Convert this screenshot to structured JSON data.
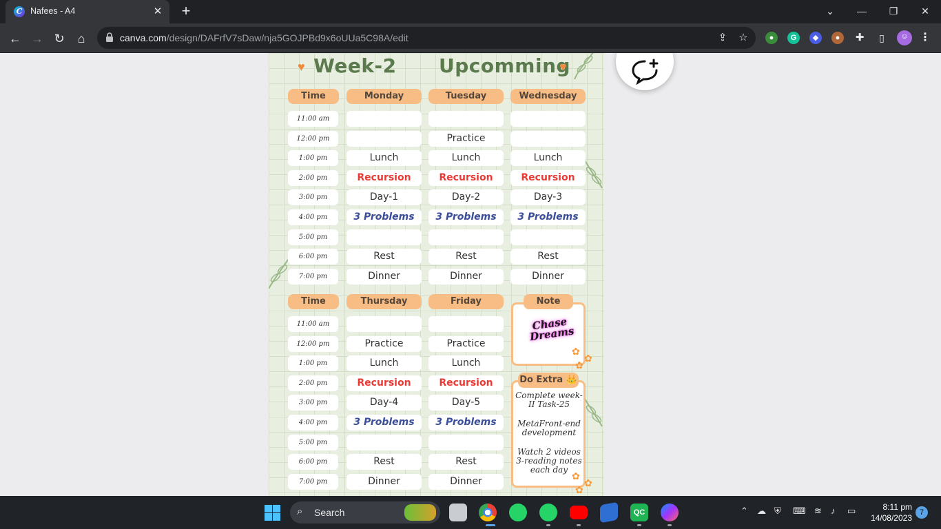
{
  "browser": {
    "tab_title": "Nafees - A4",
    "url_host": "canva.com",
    "url_path": "/design/DAFrfV7sDaw/nja5GOJPBd9x6oUUa5C98A/edit"
  },
  "design": {
    "heading_left": "Week-2",
    "heading_right": "Upcomming",
    "time_header": "Time",
    "week1": {
      "days": [
        "Monday",
        "Tuesday",
        "Wednesday"
      ],
      "times": [
        "11:00 am",
        "12:00 pm",
        "1:00 pm",
        "2:00 pm",
        "3:00 pm",
        "4:00 pm",
        "5:00 pm",
        "6:00 pm",
        "7:00 pm"
      ],
      "rows": [
        [
          "",
          "",
          ""
        ],
        [
          "",
          "Practice",
          ""
        ],
        [
          "Lunch",
          "Lunch",
          "Lunch"
        ],
        [
          "Recursion",
          "Recursion",
          "Recursion"
        ],
        [
          "Day-1",
          "Day-2",
          "Day-3"
        ],
        [
          "3 Problems",
          "3 Problems",
          "3 Problems"
        ],
        [
          "",
          "",
          ""
        ],
        [
          "Rest",
          "Rest",
          "Rest"
        ],
        [
          "Dinner",
          "Dinner",
          "Dinner"
        ]
      ]
    },
    "week2": {
      "days": [
        "Thursday",
        "Friday"
      ],
      "times": [
        "11:00 am",
        "12:00 pm",
        "1:00 pm",
        "2:00 pm",
        "3:00 pm",
        "4:00 pm",
        "5:00 pm",
        "6:00 pm",
        "7:00 pm"
      ],
      "rows": [
        [
          "",
          ""
        ],
        [
          "Practice",
          "Practice"
        ],
        [
          "Lunch",
          "Lunch"
        ],
        [
          "Recursion",
          "Recursion"
        ],
        [
          "Day-4",
          "Day-5"
        ],
        [
          "3 Problems",
          "3 Problems"
        ],
        [
          "",
          ""
        ],
        [
          "Rest",
          "Rest"
        ],
        [
          "Dinner",
          "Dinner"
        ]
      ]
    },
    "note": {
      "title": "Note",
      "art_line1": "Chase",
      "art_line2": "Dreams"
    },
    "do_extra": {
      "title": "Do Extra 👑",
      "items": [
        "Complete week-II Task-25",
        "MetaFront-end development",
        "Watch 2 videos 3-reading notes each day"
      ]
    }
  },
  "taskbar": {
    "search_label": "Search",
    "time": "8:11 pm",
    "date": "14/08/2023",
    "notification_count": "7"
  },
  "colors": {
    "heading_green": "#5b7a4e",
    "header_orange": "#f7bd85",
    "recursion_red": "#e83a34",
    "problems_blue": "#3a4e9a"
  }
}
